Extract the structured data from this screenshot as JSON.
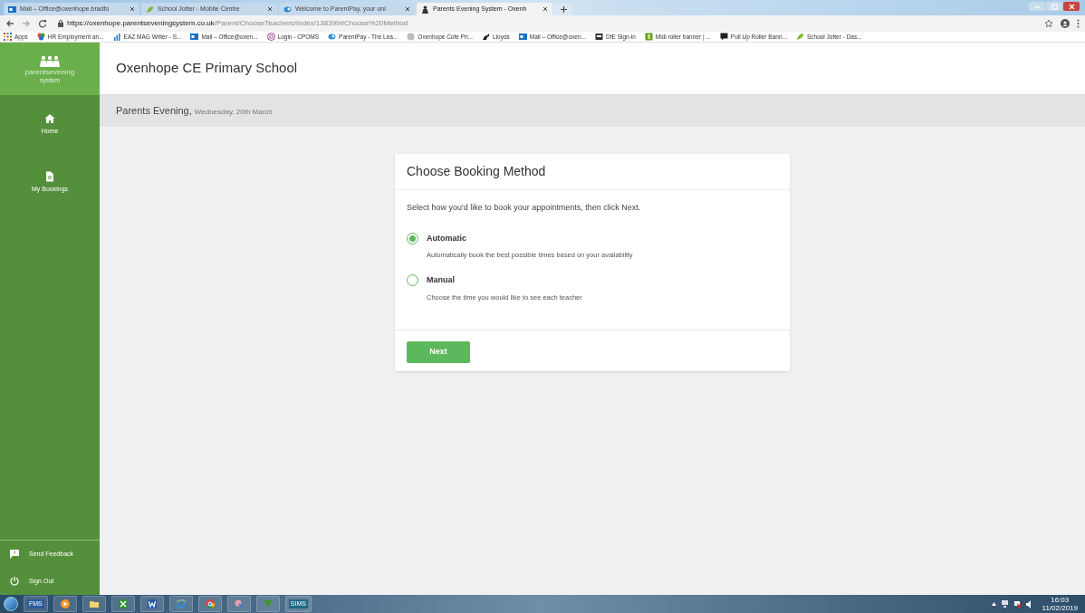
{
  "browser": {
    "tabs": [
      {
        "title": "Mail – Office@oxenhope.bradfo",
        "selected": false
      },
      {
        "title": "School Jotter - Mobile Centre",
        "selected": false
      },
      {
        "title": "Welcome to ParentPay, your onl",
        "selected": false
      },
      {
        "title": "Parents Evening System - Oxenh",
        "selected": true
      }
    ],
    "url": {
      "host": "https://oxenhope.parentseveningsystem.co.uk",
      "path": "/Parent/ChooseTeachers/Index/138399#Choose%20Method"
    },
    "bookmarks": [
      "Apps",
      "HR Employment an...",
      "EAZ MAG Writer - S...",
      "Mail – Office@oxen...",
      "Login - CPOMS",
      "ParentPay - The Lea...",
      "Oxenhope Cofe Pri...",
      "Lloyds",
      "Mail – Office@oxen...",
      "DfE Sign-in",
      "Midi roller banner | ...",
      "Pull Up Roller Bann...",
      "School Jotter - Das..."
    ]
  },
  "app": {
    "logo": {
      "name": "parentsevening",
      "sub": "system"
    },
    "nav": [
      "Home",
      "My Bookings"
    ],
    "footer_nav": [
      "Send Feedback",
      "Sign Out"
    ],
    "school": "Oxenhope CE Primary School",
    "event": {
      "title": "Parents Evening,",
      "date": "Wednesday, 20th March"
    },
    "card": {
      "title": "Choose Booking Method",
      "instructions": "Select how you'd like to book your appointments, then click Next.",
      "options": [
        {
          "label": "Automatic",
          "description": "Automatically book the best possible times based on your availability",
          "selected": true
        },
        {
          "label": "Manual",
          "description": "Choose the time you would like to see each teacher",
          "selected": false
        }
      ],
      "button": "Next"
    }
  },
  "taskbar": {
    "fms_label": "FMS",
    "sims_label": "SIMS",
    "time": "16:03",
    "date": "11/02/2019"
  }
}
